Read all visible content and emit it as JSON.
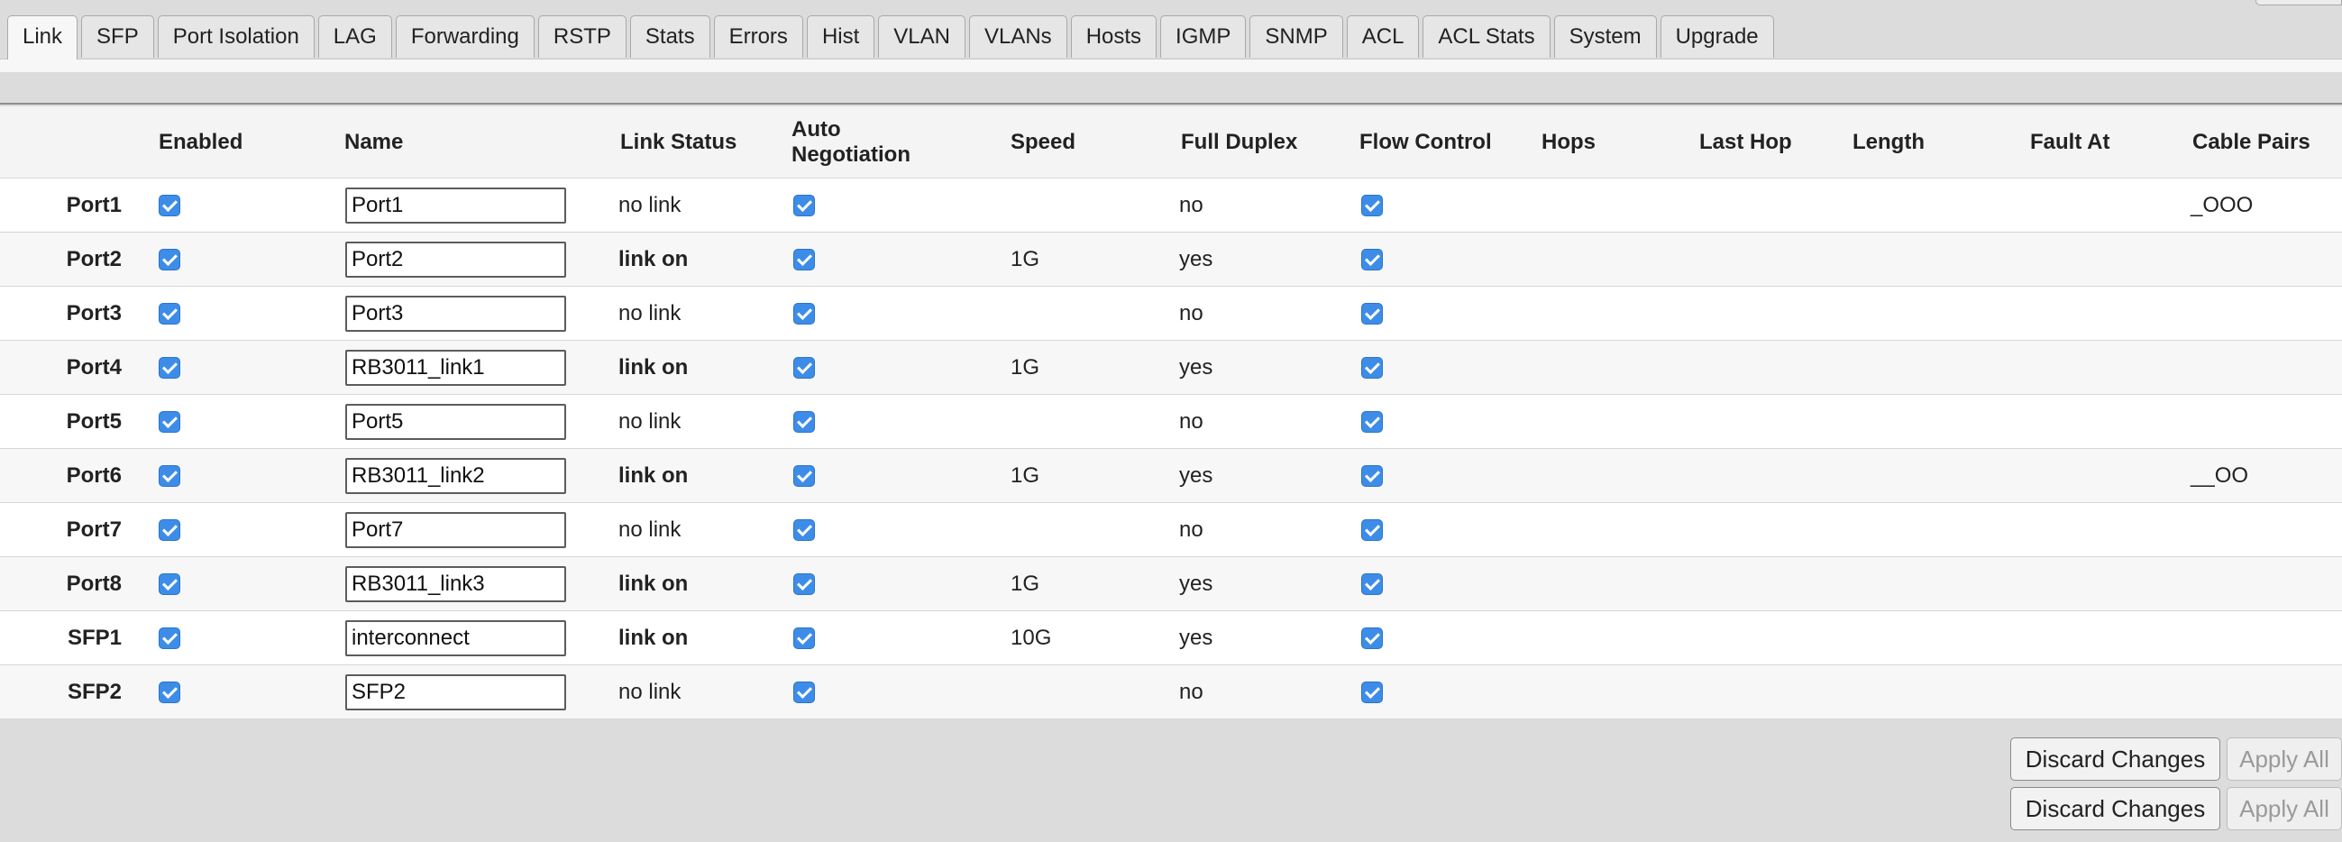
{
  "tabs": [
    {
      "label": "Link"
    },
    {
      "label": "SFP"
    },
    {
      "label": "Port Isolation"
    },
    {
      "label": "LAG"
    },
    {
      "label": "Forwarding"
    },
    {
      "label": "RSTP"
    },
    {
      "label": "Stats"
    },
    {
      "label": "Errors"
    },
    {
      "label": "Hist"
    },
    {
      "label": "VLAN"
    },
    {
      "label": "VLANs"
    },
    {
      "label": "Hosts"
    },
    {
      "label": "IGMP"
    },
    {
      "label": "SNMP"
    },
    {
      "label": "ACL"
    },
    {
      "label": "ACL Stats"
    },
    {
      "label": "System"
    },
    {
      "label": "Upgrade"
    }
  ],
  "active_tab": "Link",
  "columns": {
    "enabled": "Enabled",
    "name": "Name",
    "link_status": "Link Status",
    "auto_negotiation_1": "Auto",
    "auto_negotiation_2": "Negotiation",
    "speed": "Speed",
    "full_duplex": "Full Duplex",
    "flow_control": "Flow Control",
    "hops": "Hops",
    "last_hop": "Last Hop",
    "length": "Length",
    "fault_at": "Fault At",
    "cable_pairs": "Cable Pairs"
  },
  "rows": [
    {
      "port": "Port1",
      "enabled": true,
      "name": "Port1",
      "link_status": "no link",
      "link_on": false,
      "auto_negotiation": true,
      "speed": "",
      "full_duplex": "no",
      "flow_control": true,
      "hops": "",
      "last_hop": "",
      "length": "",
      "fault_at": "",
      "cable_pairs": "_OOO"
    },
    {
      "port": "Port2",
      "enabled": true,
      "name": "Port2",
      "link_status": "link on",
      "link_on": true,
      "auto_negotiation": true,
      "speed": "1G",
      "full_duplex": "yes",
      "flow_control": true,
      "hops": "",
      "last_hop": "",
      "length": "",
      "fault_at": "",
      "cable_pairs": ""
    },
    {
      "port": "Port3",
      "enabled": true,
      "name": "Port3",
      "link_status": "no link",
      "link_on": false,
      "auto_negotiation": true,
      "speed": "",
      "full_duplex": "no",
      "flow_control": true,
      "hops": "",
      "last_hop": "",
      "length": "",
      "fault_at": "",
      "cable_pairs": ""
    },
    {
      "port": "Port4",
      "enabled": true,
      "name": "RB3011_link1",
      "link_status": "link on",
      "link_on": true,
      "auto_negotiation": true,
      "speed": "1G",
      "full_duplex": "yes",
      "flow_control": true,
      "hops": "",
      "last_hop": "",
      "length": "",
      "fault_at": "",
      "cable_pairs": ""
    },
    {
      "port": "Port5",
      "enabled": true,
      "name": "Port5",
      "link_status": "no link",
      "link_on": false,
      "auto_negotiation": true,
      "speed": "",
      "full_duplex": "no",
      "flow_control": true,
      "hops": "",
      "last_hop": "",
      "length": "",
      "fault_at": "",
      "cable_pairs": ""
    },
    {
      "port": "Port6",
      "enabled": true,
      "name": "RB3011_link2",
      "link_status": "link on",
      "link_on": true,
      "auto_negotiation": true,
      "speed": "1G",
      "full_duplex": "yes",
      "flow_control": true,
      "hops": "",
      "last_hop": "",
      "length": "",
      "fault_at": "",
      "cable_pairs": "__OO"
    },
    {
      "port": "Port7",
      "enabled": true,
      "name": "Port7",
      "link_status": "no link",
      "link_on": false,
      "auto_negotiation": true,
      "speed": "",
      "full_duplex": "no",
      "flow_control": true,
      "hops": "",
      "last_hop": "",
      "length": "",
      "fault_at": "",
      "cable_pairs": ""
    },
    {
      "port": "Port8",
      "enabled": true,
      "name": "RB3011_link3",
      "link_status": "link on",
      "link_on": true,
      "auto_negotiation": true,
      "speed": "1G",
      "full_duplex": "yes",
      "flow_control": true,
      "hops": "",
      "last_hop": "",
      "length": "",
      "fault_at": "",
      "cable_pairs": ""
    },
    {
      "port": "SFP1",
      "enabled": true,
      "name": "interconnect",
      "link_status": "link on",
      "link_on": true,
      "auto_negotiation": true,
      "speed": "10G",
      "full_duplex": "yes",
      "flow_control": true,
      "hops": "",
      "last_hop": "",
      "length": "",
      "fault_at": "",
      "cable_pairs": ""
    },
    {
      "port": "SFP2",
      "enabled": true,
      "name": "SFP2",
      "link_status": "no link",
      "link_on": false,
      "auto_negotiation": true,
      "speed": "",
      "full_duplex": "no",
      "flow_control": true,
      "hops": "",
      "last_hop": "",
      "length": "",
      "fault_at": "",
      "cable_pairs": ""
    }
  ],
  "actions": {
    "discard_label": "Discard Changes",
    "apply_label": "Apply All",
    "apply_enabled": false
  },
  "colors": {
    "checkbox": "#3d8de8",
    "background": "#dcdcdc",
    "row_alt": "#f7f7f7"
  }
}
